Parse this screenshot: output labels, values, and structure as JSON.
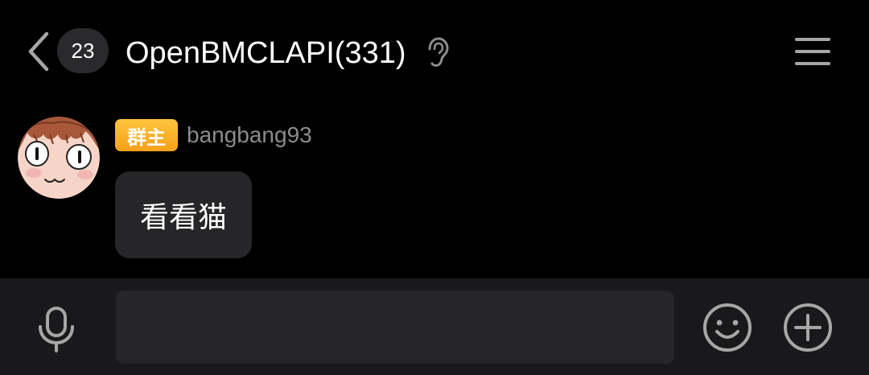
{
  "header": {
    "unread_count": "23",
    "title": "OpenBMCLAPI(331)",
    "back_icon": "chevron-left-icon",
    "earpiece_icon": "ear-icon",
    "menu_icon": "hamburger-menu-icon"
  },
  "message": {
    "role_badge": "群主",
    "sender_name": "bangbang93",
    "text": "看看猫",
    "avatar_icon": "anime-avatar"
  },
  "input_bar": {
    "value": "",
    "mic_icon": "microphone-icon",
    "emoji_icon": "smiley-icon",
    "plus_icon": "plus-circle-icon"
  },
  "colors": {
    "background": "#000000",
    "bubble": "#262628",
    "input_bar": "#19191b",
    "input_field": "#262528",
    "badge_orange": "#f6a019",
    "name_gray": "#8c8c8c",
    "icon_gray": "#a6a6a6"
  }
}
